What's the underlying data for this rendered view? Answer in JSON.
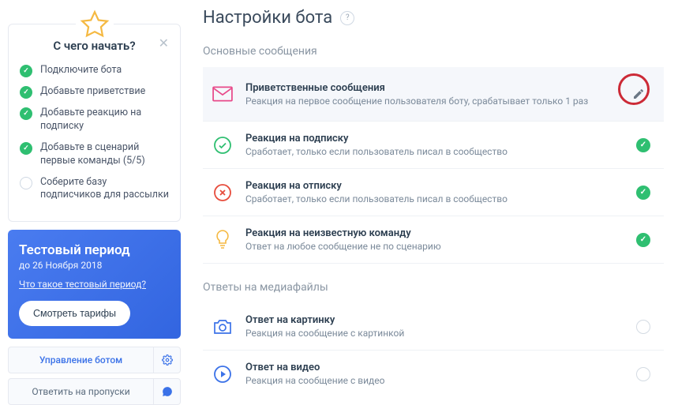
{
  "onboarding": {
    "title": "С чего начать?",
    "items": [
      {
        "label": "Подключите бота",
        "done": true
      },
      {
        "label": "Добавьте приветствие",
        "done": true
      },
      {
        "label": "Добавьте реакцию на подписку",
        "done": true
      },
      {
        "label": "Добавьте в сценарий первые команды (5/5)",
        "done": true
      },
      {
        "label": "Соберите базу подписчиков для рассылки",
        "done": false
      }
    ]
  },
  "trial": {
    "title": "Тестовый период",
    "until": "до 26 Ноября 2018",
    "what_link": "Что такое тестовый период?",
    "cta": "Смотреть тарифы"
  },
  "sidebar_buttons": {
    "manage": "Управление ботом",
    "reply": "Ответить на пропуски"
  },
  "page": {
    "title": "Настройки бота"
  },
  "sections": {
    "main": "Основные сообщения",
    "media": "Ответы на медиафайлы"
  },
  "rows": {
    "welcome": {
      "title": "Приветственные сообщения",
      "desc": "Реакция на первое сообщение пользователя боту, срабатывает только 1 раз"
    },
    "subscribe": {
      "title": "Реакция на подписку",
      "desc": "Сработает, только если пользователь писал в сообщество"
    },
    "unsubscribe": {
      "title": "Реакция на отписку",
      "desc": "Сработает, только если пользователь писал в сообщество"
    },
    "unknown": {
      "title": "Реакция на неизвестную команду",
      "desc": "Ответ на любое сообщение не по сценарию"
    },
    "image": {
      "title": "Ответ на картинку",
      "desc": "Реакция на сообщение с картинкой"
    },
    "video": {
      "title": "Ответ на видео",
      "desc": "Реакция на сообщение с видео"
    }
  },
  "colors": {
    "pink": "#e84a8a",
    "green": "#2fbf71",
    "red": "#e74c3c",
    "yellow": "#f5b942",
    "blue": "#3b72e8"
  }
}
